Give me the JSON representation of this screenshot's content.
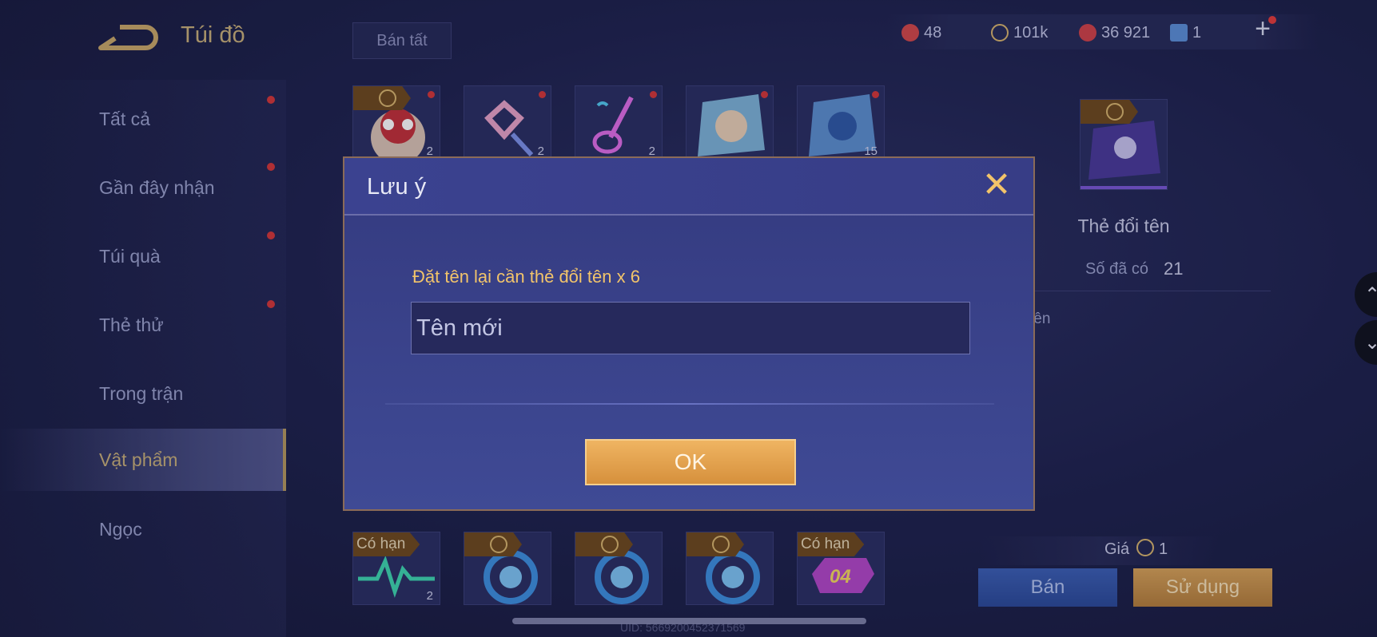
{
  "header": {
    "title": "Túi đồ",
    "sell_all": "Bán tất",
    "currencies": [
      {
        "name": "vouchers",
        "value": "48",
        "color": "#d3494b"
      },
      {
        "name": "gold",
        "value": "101k",
        "color": "#d8b56e"
      },
      {
        "name": "tickets",
        "value": "36 921",
        "color": "#d0434a"
      },
      {
        "name": "cards",
        "value": "1",
        "color": "#5c8fd8"
      }
    ]
  },
  "sidebar": {
    "items": [
      {
        "label": "Tất cả"
      },
      {
        "label": "Gần đây nhận"
      },
      {
        "label": "Túi quà"
      },
      {
        "label": "Thẻ thử"
      },
      {
        "label": "Trong trận"
      },
      {
        "label": "Vật phẩm"
      },
      {
        "label": "Ngọc"
      }
    ],
    "active": "Vật phẩm"
  },
  "grid": {
    "top_row": [
      {
        "name": "lion-dance-avatar",
        "qty": "2"
      },
      {
        "name": "heart-wand",
        "qty": "2"
      },
      {
        "name": "neon-guitar",
        "qty": "2"
      },
      {
        "name": "hero-crystal",
        "qty": ""
      },
      {
        "name": "blue-crystal",
        "qty": "15"
      }
    ],
    "bottom_row": [
      {
        "tag": "Có hạn",
        "qty": "2"
      },
      {
        "tag": "",
        "qty": ""
      },
      {
        "tag": "",
        "qty": ""
      },
      {
        "tag": "",
        "qty": ""
      },
      {
        "tag": "Có hạn",
        "qty": ""
      }
    ],
    "bottom_badge_text": "04"
  },
  "detail": {
    "name": "Thẻ đổi tên",
    "owned_label": "Số đã có",
    "owned_value": "21",
    "desc_fragment": "tên",
    "price_label": "Giá",
    "price_value": "1",
    "sell_button": "Bán",
    "use_button": "Sử dụng"
  },
  "footer": {
    "uid": "UID: 5669200452371569"
  },
  "modal": {
    "title": "Lưu ý",
    "message": "Đặt tên lại cần thẻ đổi tên x 6",
    "input_placeholder": "Tên mới",
    "ok_button": "OK"
  }
}
